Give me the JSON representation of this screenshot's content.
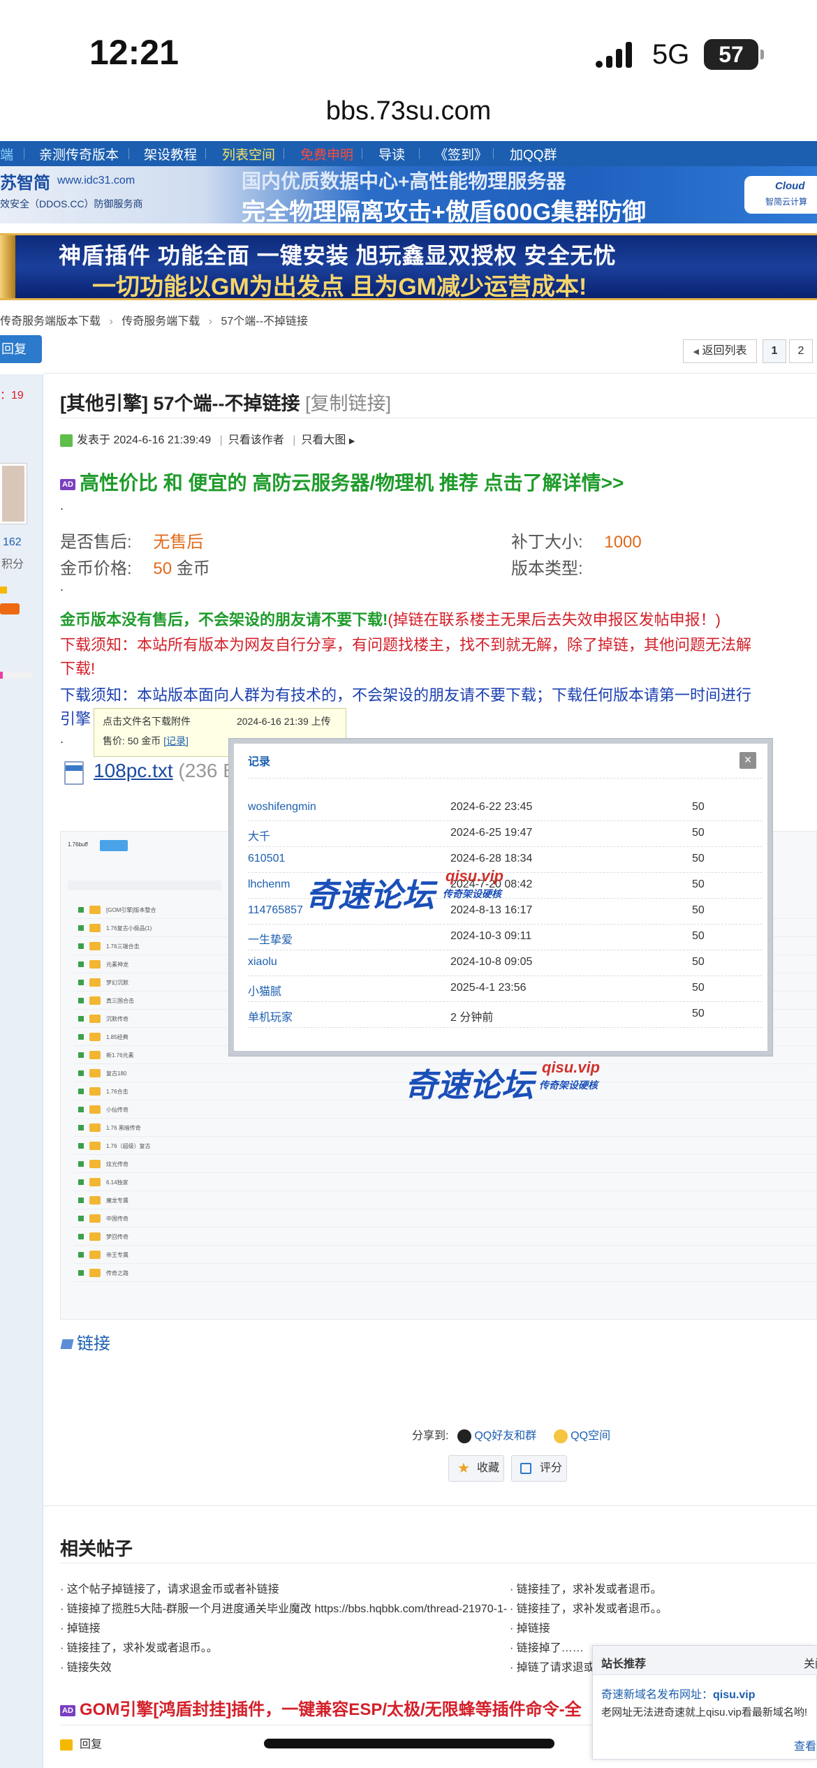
{
  "status": {
    "time": "12:21",
    "network": "5G",
    "battery": "57"
  },
  "browser": {
    "url": "bbs.73su.com"
  },
  "nav": {
    "items": [
      "端",
      "亲测传奇版本",
      "架设教程",
      "列表空间",
      "免费申明",
      "导读",
      "《签到》",
      "加QQ群"
    ],
    "highlight_yellow": "列表空间",
    "highlight_red": "免费申明"
  },
  "banner1": {
    "brand": "苏智简",
    "site": "www.idc31.com",
    "tagline": "效安全（DDOS.CC）防御服务商",
    "line1": "国内优质数据中心+高性能物理服务器",
    "line2": "完全物理隔离攻击+傲盾600G集群防御",
    "badge_top": "Cloud",
    "badge_bottom": "智简云计算"
  },
  "banner2": {
    "line1": "神盾插件  功能全面  一键安装  旭玩鑫显双授权  安全无忧",
    "line2": "一切功能以GM为出发点 且为GM减少运营成本!"
  },
  "breadcrumb": [
    "传奇服务端版本下载",
    "传奇服务端下载",
    "57个端--不掉链接"
  ],
  "toolbar": {
    "reply": "回复",
    "back": "返回列表",
    "pages": [
      "1",
      "2"
    ]
  },
  "left": {
    "count_prefix": "：",
    "count": "19",
    "score": "162",
    "score_label": "积分"
  },
  "thread": {
    "category": "[其他引擎]",
    "title": "57个端--不掉链接",
    "copy_link": "[复制链接]",
    "posted": "发表于 2024-6-16 21:39:49",
    "only_author": "只看该作者",
    "only_big": "只看大图",
    "ad_label": "AD",
    "promo": "高性价比 和 便宜的 高防云服务器/物理机 推荐 点击了解详情>>",
    "dot": ".",
    "after_sale_label": "是否售后:",
    "after_sale_value": "无售后",
    "patch_label": "补丁大小:",
    "patch_value": "1000",
    "price_label": "金币价格:",
    "price_value": "50",
    "price_unit": "金币",
    "version_label": "版本类型:",
    "notice_green": "金币版本没有售后，不会架设的朋友请不要下载!",
    "notice_red_part": "(掉链在联系楼主无果后去失效申报区发帖申报！)",
    "notice_red": "下载须知：本站所有版本为网友自行分享，有问题找楼主，找不到就无解，除了掉链，其他问题无法解",
    "notice_red2": "下载!",
    "notice_blue": "下载须知：本站版本面向人群为有技术的，不会架设的朋友请不要下载；下载任何版本请第一时间进行",
    "notice_blue2": "引擎",
    "file_name": "108pc.txt",
    "file_size": "(236 B"
  },
  "tooltip": {
    "line1": "点击文件名下载附件",
    "time": "2024-6-16 21:39 上传",
    "price": "售价: 50 金币",
    "record": "[记录]"
  },
  "dialog": {
    "title": "记录",
    "close": "×",
    "rows": [
      {
        "user": "woshifengmin",
        "date": "2024-6-22 23:45",
        "price": "50"
      },
      {
        "user": "大千",
        "date": "2024-6-25 19:47",
        "price": "50"
      },
      {
        "user": "610501",
        "date": "2024-6-28 18:34",
        "price": "50"
      },
      {
        "user": "lhchenm",
        "date": "2024-7-20 08:42",
        "price": "50"
      },
      {
        "user": "114765857",
        "date": "2024-8-13 16:17",
        "price": "50"
      },
      {
        "user": "一生挚爱",
        "date": "2024-10-3 09:11",
        "price": "50"
      },
      {
        "user": "xiaolu",
        "date": "2024-10-8 09:05",
        "price": "50"
      },
      {
        "user": "小猫腻",
        "date": "2025-4-1 23:56",
        "price": "50"
      },
      {
        "user": "单机玩家",
        "date": "2 分钟前",
        "price": "50"
      }
    ]
  },
  "watermark": {
    "main": "奇速论坛",
    "domain": "qisu.vip",
    "sub": "传奇架设硬核"
  },
  "screenshot_rows": [
    "1.76buff",
    "[GOM引擎]版本整合",
    "1.76复古小极品(1)",
    "1.76三端合击",
    "元素神龙",
    "梦幻沉默",
    "真三国合击",
    "沉默传奇",
    "1.85经典",
    "新1.76元素",
    "复古180",
    "1.76合击",
    "小仙传奇",
    "1.76 黑暗传奇",
    "1.76（超级）复古",
    "炫光传奇",
    "6.14独家",
    "魔龙专属",
    "中国传奇",
    "梦回传奇",
    "帝王专属",
    "传奇之路"
  ],
  "tag": "链接",
  "share": {
    "label": "分享到:",
    "qq_friends": "QQ好友和群",
    "qq_zone": "QQ空间"
  },
  "actions": {
    "favorite": "收藏",
    "rate": "评分"
  },
  "related": {
    "title": "相关帖子",
    "left": [
      "这个帖子掉链接了，请求退金币或者补链接",
      "链接掉了揽胜5大陆-群服一个月进度通关毕业魔改 https://bbs.hqbbk.com/thread-21970-1-",
      "掉链接",
      "链接挂了，求补发或者退币。。",
      "链接失效"
    ],
    "right": [
      "链接挂了，求补发或者退币。",
      "链接挂了，求补发或者退币。。",
      "掉链接",
      "链接掉了……",
      "掉链了请求退或"
    ]
  },
  "gom": {
    "ad": "AD",
    "text": "GOM引擎[鸿盾封挂]插件，一键兼容ESP/太极/无限蜂等插件命令-全"
  },
  "reply_small": "回复",
  "recommend": {
    "title": "站长推荐",
    "close": "关闭",
    "headline_prefix": "奇速新域名发布网址：",
    "headline_link": "qisu.vip",
    "body": "老网址无法进奇速就上qisu.vip看最新域名哟!",
    "more": "查看"
  }
}
